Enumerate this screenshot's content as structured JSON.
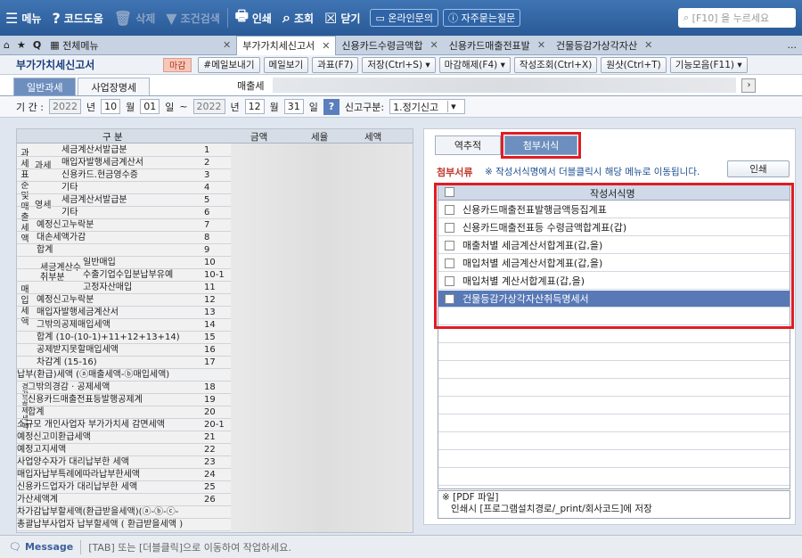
{
  "toolbar": {
    "menu_label": "메뉴",
    "code_help_label": "코드도움",
    "delete_label": "삭제",
    "filter_label": "조건검색",
    "print_label": "인쇄",
    "search_label": "조회",
    "close_label": "닫기",
    "online_inquiry_label": "온라인문의",
    "faq_label": "자주묻는질문",
    "search_placeholder": "[F10] 을 누르세요"
  },
  "tabs": [
    {
      "label": "전체메뉴"
    },
    {
      "label": "부가가치세신고서"
    },
    {
      "label": "신용카드수령금액합"
    },
    {
      "label": "신용카드매출전표발"
    },
    {
      "label": "건물등감가상각자산"
    }
  ],
  "tabs_more": "...",
  "page": {
    "title": "부가가치세신고서",
    "closing_badge": "마감",
    "buttons": [
      "#메일보내기",
      "메일보기",
      "과표(F7)",
      "저장(Ctrl+S)",
      "마감해제(F4)",
      "작성조회(Ctrl+X)",
      "원샷(Ctrl+T)",
      "기능모음(F11)"
    ]
  },
  "subtabs": {
    "general": "일반과세",
    "business": "사업장명세"
  },
  "business_label": "매출세",
  "period": {
    "label": "기 간 :",
    "from_year": "2022",
    "year_unit": "년",
    "from_month": "10",
    "month_unit": "월",
    "from_day": "01",
    "day_unit": "일",
    "tilde": "~",
    "to_year": "2022",
    "to_month": "12",
    "to_day": "31",
    "report_type_label": "신고구분:",
    "report_type_value": "1.정기신고"
  },
  "left_table": {
    "headers": {
      "category": "구 분",
      "amount": "금액",
      "rate": "세율",
      "tax": "세액"
    },
    "vertical_labels": {
      "sales": "과세표준및매출세액",
      "purchase": "매입세액",
      "deduction": "경감공제세액"
    },
    "group_labels": {
      "taxable": "과세",
      "zero_rate": "영세",
      "tax_invoice_recv": "세금계산수취부분"
    },
    "rows": [
      {
        "label": "세금계산서발급분",
        "no": "1"
      },
      {
        "label": "매입자발행세금계산서",
        "no": "2"
      },
      {
        "label": "신용카드.현금영수증",
        "no": "3"
      },
      {
        "label": "기타",
        "no": "4"
      },
      {
        "label": "세금계산서발급분",
        "no": "5"
      },
      {
        "label": "기타",
        "no": "6"
      },
      {
        "label": "예정신고누락분",
        "no": "7"
      },
      {
        "label": "대손세액가감",
        "no": "8"
      },
      {
        "label": "합계",
        "no": "9"
      },
      {
        "label": "일반매입",
        "no": "10"
      },
      {
        "label": "수출기업수입분납부유예",
        "no": "10-1"
      },
      {
        "label": "고정자산매입",
        "no": "11"
      },
      {
        "label": "예정신고누락분",
        "no": "12"
      },
      {
        "label": "매입자발행세금계산서",
        "no": "13"
      },
      {
        "label": "그밖의공제매입세액",
        "no": "14"
      },
      {
        "label": "합계 (10-(10-1)+11+12+13+14)",
        "no": "15"
      },
      {
        "label": "공제받지못할매입세액",
        "no": "16"
      },
      {
        "label": "차감계 (15-16)",
        "no": "17"
      },
      {
        "label": "납부(환급)세액 (ⓐ매출세액-ⓑ매입세액)",
        "no": ""
      },
      {
        "label": "그밖의경감 · 공제세액",
        "no": "18"
      },
      {
        "label": "신용카드매출전표등발행공제계",
        "no": "19"
      },
      {
        "label": "합계",
        "no": "20"
      },
      {
        "label": "소규모 개인사업자 부가가치세 감면세액",
        "no": "20-1"
      },
      {
        "label": "예정신고미환급세액",
        "no": "21"
      },
      {
        "label": "예정고지세액",
        "no": "22"
      },
      {
        "label": "사업양수자가 대리납부한 세액",
        "no": "23"
      },
      {
        "label": "매입자납부특례에따라납부한세액",
        "no": "24"
      },
      {
        "label": "신용카드업자가 대리납부한 세액",
        "no": "25"
      },
      {
        "label": "가산세액계",
        "no": "26"
      },
      {
        "label": "차가감납부할세액(환급받을세액)(ⓐ-ⓑ-ⓒ-",
        "no": ""
      },
      {
        "label": "총괄납부사업자 납부할세액 ( 환급받을세액 )",
        "no": ""
      }
    ]
  },
  "right_panel": {
    "tab_reverse": "역추적",
    "tab_attachments": "첨부서식",
    "attach_label": "첨부서류",
    "hint": "※ 작성서식명에서 더블클릭시 해당 메뉴로 이동됩니다.",
    "print_button": "인쇄",
    "grid_header": "작성서식명",
    "forms": [
      {
        "name": "신용카드매출전표발행금액등집계표",
        "selected": false
      },
      {
        "name": "신용카드매출전표등 수령금액합계표(갑)",
        "selected": false
      },
      {
        "name": "매출처별 세금계산서합계표(갑,을)",
        "selected": false
      },
      {
        "name": "매입처별 세금계산서합계표(갑,을)",
        "selected": false
      },
      {
        "name": "매입처별 계산서합계표(갑,을)",
        "selected": false
      },
      {
        "name": "건물등감가상각자산취득명세서",
        "selected": true
      }
    ],
    "note_line1": "※ [PDF 파일]",
    "note_line2": "인쇄시 [프로그램설치경로/_print/회사코드]에 저장"
  },
  "status": {
    "message_label": "Message",
    "message_text": "[TAB] 또는 [더블클릭]으로 이동하여 작업하세요."
  }
}
